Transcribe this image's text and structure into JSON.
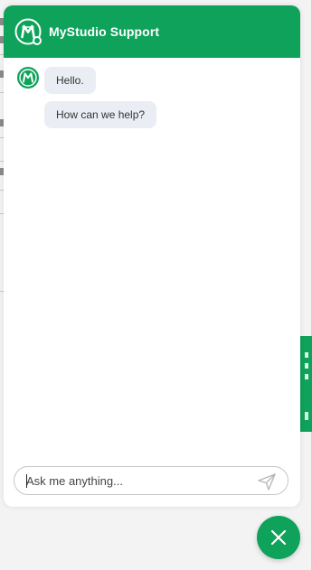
{
  "header": {
    "title": "MyStudio Support"
  },
  "messages": [
    {
      "text": "Hello."
    },
    {
      "text": "How can we help?"
    }
  ],
  "composer": {
    "placeholder": "Ask me anything..."
  },
  "icons": {
    "header_logo": "mystudio-logo-icon",
    "bot_avatar": "mystudio-logo-icon",
    "send": "paper-plane-send-icon",
    "close": "close-x-icon"
  },
  "colors": {
    "brand_green": "#0ea25a",
    "bubble_bg": "#eaeef4",
    "page_bg": "#f3f3f3"
  }
}
